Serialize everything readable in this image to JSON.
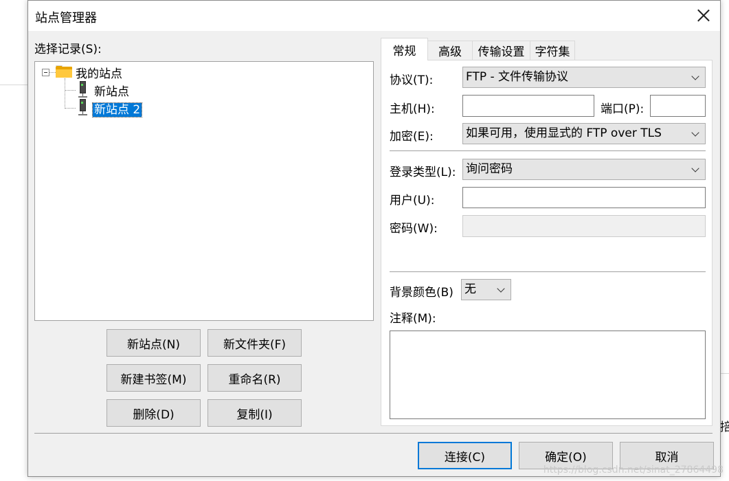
{
  "dialog": {
    "title": "站点管理器"
  },
  "left": {
    "select_label": "选择记录(S):",
    "tree": {
      "root": "我的站点",
      "children": [
        "新站点",
        "新站点 2"
      ],
      "selected_index": 1
    },
    "buttons": {
      "new_site": "新站点(N)",
      "new_folder": "新文件夹(F)",
      "new_bookmark": "新建书签(M)",
      "rename": "重命名(R)",
      "delete": "删除(D)",
      "copy": "复制(I)"
    }
  },
  "tabs": [
    "常规",
    "高级",
    "传输设置",
    "字符集"
  ],
  "active_tab": 0,
  "general": {
    "protocol_label": "协议(T):",
    "protocol_value": "FTP - 文件传输协议",
    "host_label": "主机(H):",
    "host_value": "",
    "port_label": "端口(P):",
    "port_value": "",
    "encryption_label": "加密(E):",
    "encryption_value": "如果可用，使用显式的 FTP over TLS",
    "logon_type_label": "登录类型(L):",
    "logon_type_value": "询问密码",
    "user_label": "用户(U):",
    "user_value": "",
    "password_label": "密码(W):",
    "password_value": "",
    "bg_color_label": "背景颜色(B)",
    "bg_color_value": "无",
    "comments_label": "注释(M):",
    "comments_value": ""
  },
  "footer": {
    "connect": "连接(C)",
    "ok": "确定(O)",
    "cancel": "取消"
  },
  "watermark": "https://blog.csdn.net/sinat_27864498",
  "edge_char": "掊",
  "colors": {
    "selection": "#0078d7",
    "dialog_bg": "#f0f0f0",
    "folder": "#ffc83d"
  }
}
